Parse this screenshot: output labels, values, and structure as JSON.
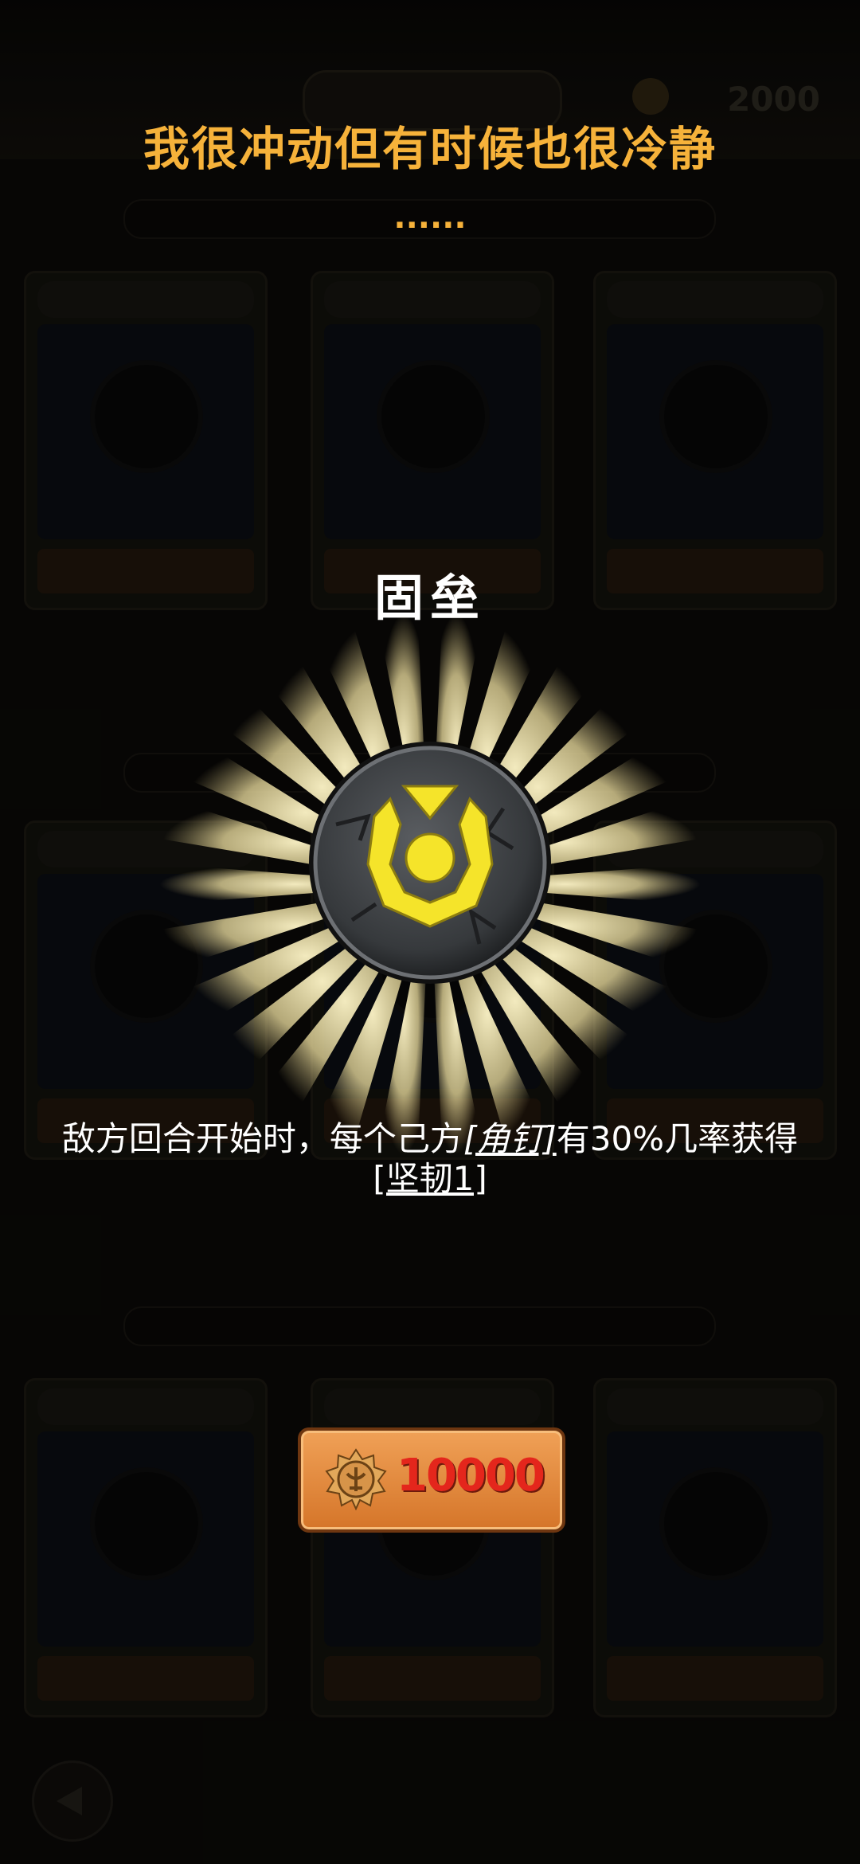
{
  "header": {
    "title": "我很冲动但有时候也很冷静",
    "subtitle": "......"
  },
  "skill": {
    "name": "固垒",
    "icon": "shield-rune-icon",
    "description_part1": "敌方回合开始时，每个己方",
    "keyword1": "[角钉]",
    "description_part2": "有30%几率获得",
    "keyword2": "[坚韧1]"
  },
  "cost_button": {
    "value": "10000",
    "currency_icon": "medal-icon"
  },
  "background": {
    "coin_amount": "2000"
  },
  "colors": {
    "title": "#f6b23a",
    "button": "#d57529",
    "cost_text": "#e4261c",
    "rune": "#f5e42a"
  }
}
